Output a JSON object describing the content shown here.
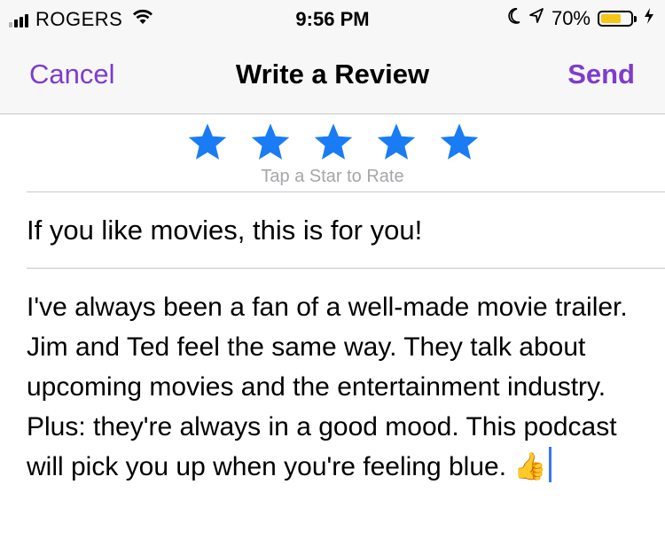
{
  "status_bar": {
    "carrier": "ROGERS",
    "time": "9:56 PM",
    "battery_percent": "70%",
    "battery_level": 0.7,
    "icons": [
      "signal-icon",
      "wifi-icon",
      "moon-icon",
      "location-icon",
      "battery-icon",
      "charging-icon"
    ]
  },
  "nav": {
    "cancel_label": "Cancel",
    "title": "Write a Review",
    "send_label": "Send"
  },
  "rating": {
    "star_count": 5,
    "selected": 5,
    "hint": "Tap a Star to Rate",
    "star_color": "#1a7cf5"
  },
  "review": {
    "title": "If you like movies, this is for you!",
    "body": "I've always been a fan of a well-made movie trailer. Jim and Ted feel the same way. They talk about upcoming movies and the entertainment industry. Plus: they're always in a good mood. This podcast will pick you up when you're feeling blue. 👍"
  },
  "colors": {
    "accent": "#7d3ccf",
    "cursor": "#3478f6",
    "battery": "#f5c518"
  }
}
